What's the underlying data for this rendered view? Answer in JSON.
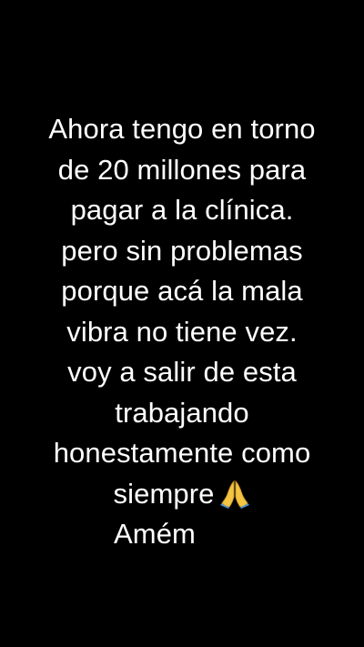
{
  "story": {
    "background": "#000000",
    "text_color": "#ffffff",
    "lines": [
      "Ahora tengo en torno",
      "de 20 millones para",
      "pagar a la clínica.",
      "pero sin problemas",
      "porque acá la mala",
      "vibra no tiene vez.",
      "voy a salir de esta",
      "trabajando",
      "honestamente como",
      "siempre",
      "Amém"
    ],
    "emoji": "praying-hands-icon"
  }
}
